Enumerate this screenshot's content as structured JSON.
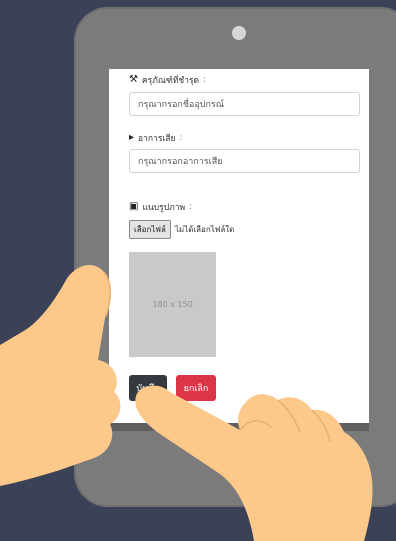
{
  "form": {
    "device_label": "ครุภัณฑ์ที่ชำรุด",
    "device_placeholder": "กรุณากรอกชื่ออุปกรณ์",
    "symptom_label": "อาการเสีย",
    "symptom_placeholder": "กรุณากรอกอาการเสีย",
    "photo_label": "แนบรูปภาพ",
    "label_suffix": ":",
    "choose_file": "เลือกไฟล์",
    "no_file": "ไม่ได้เลือกไฟล์ใด",
    "image_placeholder": "180 x 150",
    "save_button": "บันทึก",
    "cancel_button": "ยกเลิก"
  },
  "icons": {
    "device": "tools-icon",
    "symptom": "tool-icon",
    "photo": "camera-icon"
  },
  "colors": {
    "background": "#3b4157",
    "tablet": "#7b7b7b",
    "save": "#343a40",
    "cancel": "#dc3545",
    "hand": "#fcc98b"
  }
}
